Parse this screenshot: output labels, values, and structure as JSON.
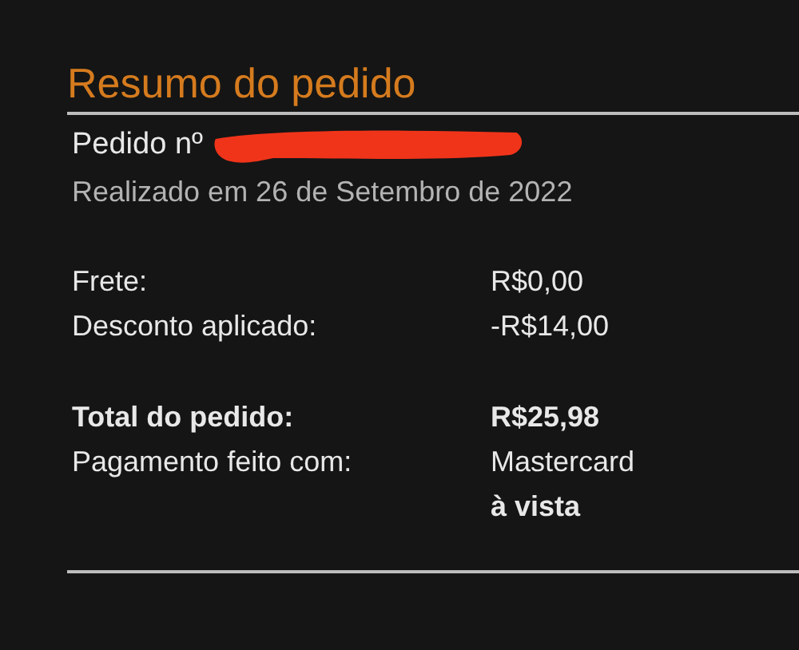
{
  "title": "Resumo do pedido",
  "order": {
    "label": "Pedido nº",
    "number_redacted": true
  },
  "placed_on": "Realizado em 26 de Setembro de 2022",
  "sections": [
    {
      "rows": [
        {
          "label": "Frete:",
          "bold": false,
          "values": [
            {
              "text": "R$0,00",
              "bold": false
            }
          ]
        },
        {
          "label": "Desconto aplicado:",
          "bold": false,
          "values": [
            {
              "text": "-R$14,00",
              "bold": false
            }
          ]
        }
      ]
    },
    {
      "rows": [
        {
          "label": "Total do pedido:",
          "bold": true,
          "values": [
            {
              "text": "R$25,98",
              "bold": true
            }
          ]
        },
        {
          "label": "Pagamento feito com:",
          "bold": false,
          "values": [
            {
              "text": "Mastercard",
              "bold": false
            },
            {
              "text": "à vista",
              "bold": true
            }
          ]
        }
      ]
    }
  ]
}
